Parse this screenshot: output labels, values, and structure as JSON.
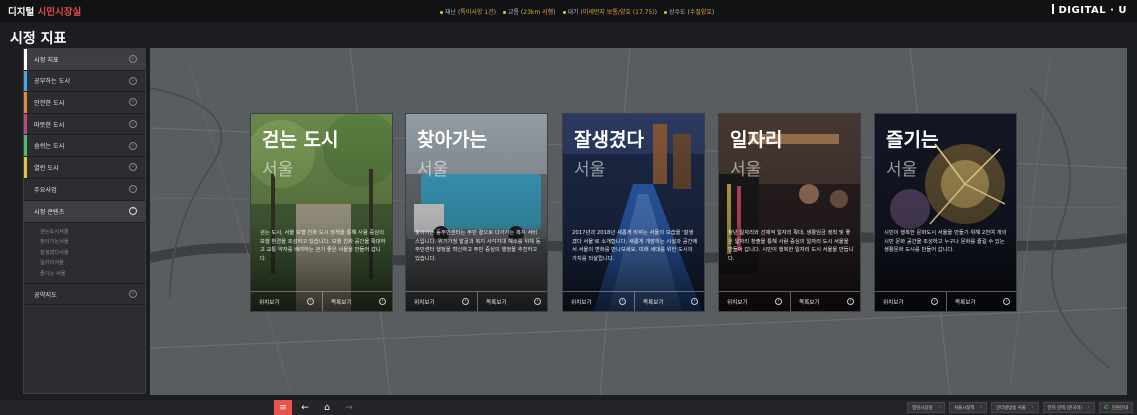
{
  "topbar": {
    "brand_main": "디지털",
    "brand_accent": "시민시장실",
    "status": [
      {
        "label": "재난 (",
        "value": "특이사항 1건",
        "tail": ")"
      },
      {
        "label": "교통 (",
        "value": "23km 서행",
        "tail": ")"
      },
      {
        "label": "대기 (",
        "value": "미세먼지 보통/양호 (17.75)",
        "tail": ")"
      },
      {
        "label": "상수도 (",
        "value": "수질양호",
        "tail": ")"
      }
    ],
    "logo": "DIGITAL · U"
  },
  "page_title": "시정 지표",
  "sidebar": {
    "items": [
      {
        "label": "시정 지표",
        "color": "#ffffff"
      },
      {
        "label": "공부하는 도시",
        "color": "#4ca3e0"
      },
      {
        "label": "안전한 도시",
        "color": "#e08a3a"
      },
      {
        "label": "따뜻한 도시",
        "color": "#c7408a"
      },
      {
        "label": "숨쉬는 도시",
        "color": "#4fb86b"
      },
      {
        "label": "열린 도시",
        "color": "#e8c13a"
      },
      {
        "label": "주요사업",
        "color": ""
      },
      {
        "label": "시정 콘텐츠",
        "color": ""
      }
    ],
    "sub_items": [
      "걷는도시서울",
      "찾아가는서울",
      "잘생겼다서울",
      "일자리서울",
      "즐기는 서울"
    ],
    "last_item": "공약지도"
  },
  "cards": [
    {
      "title": "걷는 도시",
      "subtitle": "서울",
      "desc": "걷는 도시, 서울 보행 친화 도시 정책을 통해 사람 중심의 보행 환경을 조성하고 있습니다. 보행 친화 공간을 확대하고 교통 약자를 배려하는 걷기 좋은 서울을 만들어 갑니다.",
      "loc": "위치보기",
      "list": "목록보기",
      "photo": "forest"
    },
    {
      "title": "찾아가는",
      "subtitle": "서울",
      "desc": "찾아가는 동주민센터는 주민 곁으로 다가가는 복지 서비스입니다. 위기가정 발굴과 복지 사각지대 해소를 위해 동 주민센터 행정을 혁신하고 주민 중심의 행정을 추진하고 있습니다.",
      "loc": "위치보기",
      "list": "목록보기",
      "photo": "truck"
    },
    {
      "title": "잘생겼다",
      "subtitle": "서울",
      "desc": "2017년과 2018년 새롭게 바뀌는 서울의 모습을 '잘생겼다 서울'로 소개합니다. 새롭게 개장하는 시설과 공간에서 서울의 변화를 만나보세요. 미래 세대를 위한 도시의 가치를 되살립니다.",
      "loc": "위치보기",
      "list": "목록보기",
      "photo": "night"
    },
    {
      "title": "일자리",
      "subtitle": "서울",
      "desc": "청년 일자리와 선제적 일자리 확대, 생활임금 정착 및 좋은 일자리 창출을 통해 사람 중심의 일자리 도시 서울을 만들어 갑니다. 시민이 행복한 일자리 도시 서울을 만듭니다.",
      "loc": "위치보기",
      "list": "목록보기",
      "photo": "workplace"
    },
    {
      "title": "즐기는",
      "subtitle": "서울",
      "desc": "시민이 행복한 문화도시 서울을 만들기 위해 2천여 개의 시민 문화 공간을 조성하고 누구나 문화를 즐길 수 있는 생활문화 도시를 만들어 갑니다.",
      "loc": "위치보기",
      "list": "목록보기",
      "photo": "fireworks"
    }
  ],
  "bottombar": {
    "links": [
      "열린시장실",
      "서울시정책",
      "인터넷방송 서울",
      "언어 선택 (한국어)",
      "민원안내"
    ]
  }
}
